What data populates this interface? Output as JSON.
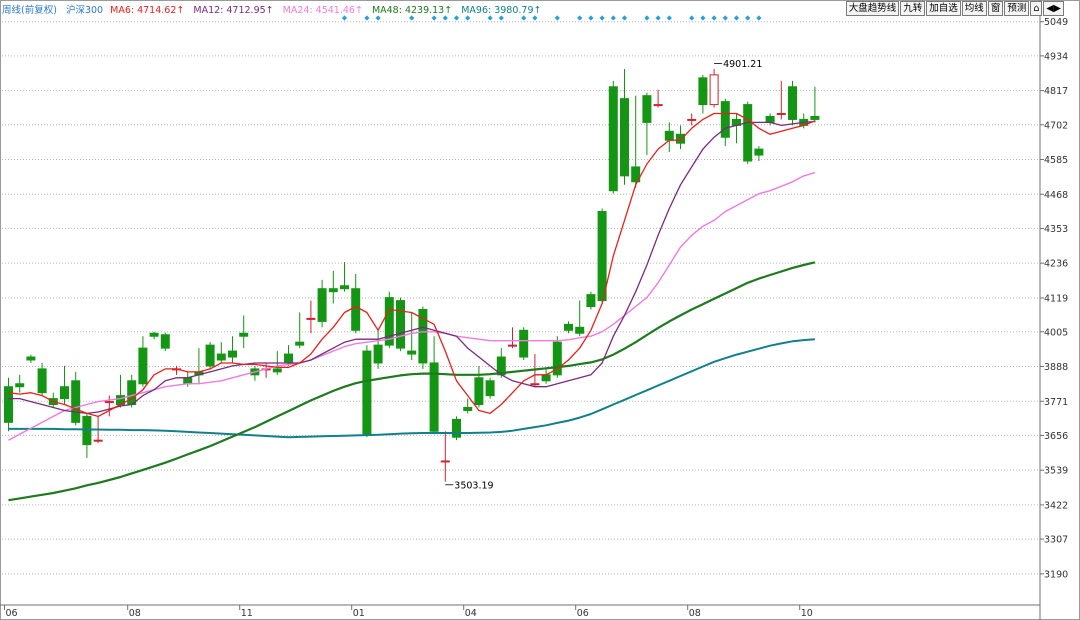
{
  "header": {
    "label": "周线(前复权)",
    "symbol": "沪深300",
    "ma": [
      {
        "text": "MA6: 4714.62↑",
        "color": "#e8201c"
      },
      {
        "text": "MA12: 4712.95↑",
        "color": "#7b2a7b"
      },
      {
        "text": "MA24: 4541.46↑",
        "color": "#f07ae0"
      },
      {
        "text": "MA48: 4239.13↑",
        "color": "#1e7a1e"
      },
      {
        "text": "MA96: 3980.79↑",
        "color": "#11808a"
      }
    ]
  },
  "toolbar": {
    "buttons": [
      "大盘趋势线",
      "九转",
      "加自选",
      "均线",
      "窗",
      "预测",
      "⌂",
      "◀▶"
    ]
  },
  "colors": {
    "up": "#d2232a",
    "down": "#149614",
    "grid": "#b8b8b8",
    "markers": "#2a9fd8",
    "ma6": "#e8201c",
    "ma12": "#7b2a7b",
    "ma24": "#f07ae0",
    "ma48": "#1e7a1e",
    "ma96": "#11808a"
  },
  "chart_data": {
    "type": "candlestick",
    "ylim": [
      3085,
      5075
    ],
    "yticks": [
      5049,
      4934,
      4817,
      4702,
      4585,
      4468,
      4353,
      4236,
      4119,
      4005,
      3888,
      3771,
      3656,
      3539,
      3422,
      3307,
      3190
    ],
    "xticks": [
      {
        "i": 0,
        "label": "06"
      },
      {
        "i": 11,
        "label": "08"
      },
      {
        "i": 21,
        "label": "11"
      },
      {
        "i": 31,
        "label": "01"
      },
      {
        "i": 41,
        "label": "04"
      },
      {
        "i": 51,
        "label": "06"
      },
      {
        "i": 61,
        "label": "08"
      },
      {
        "i": 71,
        "label": "10"
      }
    ],
    "annotations": [
      {
        "i": 63,
        "value": 4901.21,
        "text": "4901.21"
      },
      {
        "i": 39,
        "value": 3503.19,
        "text": "3503.19"
      }
    ],
    "marker_bars": [
      30,
      32,
      33,
      36,
      38,
      39,
      40,
      41,
      43,
      44,
      46,
      47,
      49,
      51,
      52,
      53,
      54,
      55,
      57,
      58,
      59,
      61,
      62,
      63,
      64,
      65,
      66,
      67
    ],
    "candles": [
      [
        3820,
        3850,
        3700,
        3670
      ],
      [
        3830,
        3860,
        3820,
        3800
      ],
      [
        3920,
        3928,
        3910,
        3900
      ],
      [
        3880,
        3900,
        3800,
        3790
      ],
      [
        3780,
        3800,
        3760,
        3750
      ],
      [
        3820,
        3890,
        3780,
        3760
      ],
      [
        3840,
        3870,
        3700,
        3690
      ],
      [
        3720,
        3730,
        3625,
        3580
      ],
      [
        3640,
        3720,
        3640,
        3630
      ],
      [
        3770,
        3790,
        3770,
        3720
      ],
      [
        3790,
        3860,
        3760,
        3750
      ],
      [
        3840,
        3860,
        3760,
        3750
      ],
      [
        3950,
        3990,
        3830,
        3820
      ],
      [
        4000,
        4005,
        3990,
        3980
      ],
      [
        3995,
        4002,
        3950,
        3940
      ],
      [
        3880,
        3890,
        3880,
        3860
      ],
      [
        3850,
        3870,
        3830,
        3820
      ],
      [
        3870,
        3950,
        3860,
        3830
      ],
      [
        3960,
        3970,
        3890,
        3880
      ],
      [
        3930,
        3970,
        3910,
        3900
      ],
      [
        3940,
        3990,
        3920,
        3900
      ],
      [
        4000,
        4060,
        3990,
        3950
      ],
      [
        3880,
        3890,
        3860,
        3840
      ],
      [
        3880,
        3900,
        3880,
        3850
      ],
      [
        3880,
        3940,
        3870,
        3860
      ],
      [
        3930,
        3960,
        3900,
        3890
      ],
      [
        3970,
        4070,
        3960,
        3950
      ],
      [
        4050,
        4110,
        4050,
        4000
      ],
      [
        4150,
        4180,
        4040,
        4020
      ],
      [
        4150,
        4210,
        4140,
        4100
      ],
      [
        4160,
        4240,
        4150,
        4140
      ],
      [
        4150,
        4200,
        4010,
        4000
      ],
      [
        3940,
        3960,
        3660,
        3650
      ],
      [
        3960,
        4010,
        3900,
        3880
      ],
      [
        4120,
        4140,
        3960,
        3950
      ],
      [
        4110,
        4120,
        3950,
        3940
      ],
      [
        3940,
        4070,
        3930,
        3910
      ],
      [
        4080,
        4090,
        3900,
        3880
      ],
      [
        3900,
        3990,
        3670,
        3660
      ],
      [
        3570,
        3670,
        3570,
        3500
      ],
      [
        3710,
        3720,
        3650,
        3640
      ],
      [
        3750,
        3780,
        3740,
        3730
      ],
      [
        3850,
        3890,
        3760,
        3750
      ],
      [
        3840,
        3850,
        3790,
        3780
      ],
      [
        3920,
        3950,
        3860,
        3850
      ],
      [
        3960,
        4020,
        3960,
        3950
      ],
      [
        4010,
        4020,
        3920,
        3910
      ],
      [
        3830,
        3930,
        3830,
        3820
      ],
      [
        3860,
        3880,
        3840,
        3830
      ],
      [
        3970,
        3990,
        3860,
        3850
      ],
      [
        4030,
        4040,
        4010,
        4000
      ],
      [
        4020,
        4110,
        4000,
        3990
      ],
      [
        4130,
        4140,
        4090,
        4080
      ],
      [
        4410,
        4420,
        4110,
        4100
      ],
      [
        4830,
        4850,
        4480,
        4470
      ],
      [
        4790,
        4890,
        4530,
        4500
      ],
      [
        4560,
        4800,
        4510,
        4490
      ],
      [
        4800,
        4810,
        4710,
        4600
      ],
      [
        4770,
        4820,
        4770,
        4760
      ],
      [
        4680,
        4710,
        4650,
        4610
      ],
      [
        4670,
        4700,
        4640,
        4620
      ],
      [
        4720,
        4740,
        4720,
        4700
      ],
      [
        4860,
        4870,
        4770,
        4740
      ],
      [
        4770,
        4890,
        4870,
        4760
      ],
      [
        4780,
        4790,
        4660,
        4630
      ],
      [
        4720,
        4740,
        4700,
        4640
      ],
      [
        4770,
        4780,
        4580,
        4570
      ],
      [
        4620,
        4630,
        4600,
        4580
      ],
      [
        4730,
        4740,
        4710,
        4700
      ],
      [
        4740,
        4850,
        4740,
        4720
      ],
      [
        4830,
        4850,
        4720,
        4700
      ],
      [
        4720,
        4740,
        4700,
        4690
      ],
      [
        4730,
        4830,
        4720,
        4710
      ]
    ],
    "ma6": [
      3800,
      3795,
      3800,
      3790,
      3770,
      3760,
      3745,
      3730,
      3720,
      3740,
      3760,
      3780,
      3810,
      3860,
      3880,
      3880,
      3870,
      3870,
      3880,
      3900,
      3900,
      3895,
      3895,
      3890,
      3885,
      3885,
      3900,
      3930,
      3980,
      4020,
      4070,
      4090,
      4070,
      4010,
      4080,
      4075,
      4070,
      4050,
      4030,
      3940,
      3840,
      3790,
      3740,
      3730,
      3760,
      3800,
      3840,
      3860,
      3860,
      3880,
      3910,
      3950,
      4010,
      4100,
      4260,
      4380,
      4500,
      4570,
      4620,
      4650,
      4650,
      4690,
      4720,
      4740,
      4740,
      4740,
      4720,
      4690,
      4670,
      4680,
      4690,
      4700,
      4715
    ],
    "ma12": [
      3780,
      3780,
      3770,
      3760,
      3750,
      3740,
      3735,
      3730,
      3735,
      3745,
      3755,
      3760,
      3790,
      3810,
      3840,
      3850,
      3850,
      3860,
      3870,
      3880,
      3890,
      3895,
      3900,
      3900,
      3900,
      3900,
      3900,
      3910,
      3930,
      3950,
      3970,
      3980,
      3980,
      3980,
      3990,
      4000,
      4010,
      4020,
      4010,
      4000,
      3990,
      3950,
      3920,
      3890,
      3860,
      3840,
      3830,
      3820,
      3820,
      3830,
      3840,
      3850,
      3860,
      3900,
      3990,
      4060,
      4140,
      4230,
      4330,
      4420,
      4500,
      4560,
      4620,
      4660,
      4690,
      4700,
      4710,
      4710,
      4710,
      4700,
      4705,
      4710,
      4713
    ],
    "ma24": [
      3640,
      3660,
      3680,
      3700,
      3720,
      3740,
      3750,
      3760,
      3770,
      3775,
      3780,
      3790,
      3800,
      3810,
      3820,
      3825,
      3830,
      3830,
      3835,
      3840,
      3850,
      3860,
      3870,
      3880,
      3890,
      3895,
      3900,
      3910,
      3925,
      3940,
      3955,
      3965,
      3970,
      3975,
      3980,
      3990,
      4000,
      4005,
      4005,
      4000,
      3990,
      3985,
      3980,
      3975,
      3975,
      3975,
      3975,
      3975,
      3975,
      3975,
      3978,
      3985,
      3990,
      4005,
      4030,
      4060,
      4090,
      4120,
      4170,
      4230,
      4290,
      4330,
      4360,
      4380,
      4410,
      4430,
      4450,
      4470,
      4480,
      4495,
      4510,
      4530,
      4541
    ],
    "ma48": [
      3438,
      3444,
      3450,
      3456,
      3462,
      3470,
      3478,
      3488,
      3496,
      3506,
      3516,
      3528,
      3540,
      3552,
      3564,
      3578,
      3592,
      3606,
      3620,
      3636,
      3652,
      3668,
      3684,
      3702,
      3720,
      3738,
      3756,
      3774,
      3790,
      3806,
      3820,
      3832,
      3840,
      3846,
      3852,
      3858,
      3862,
      3864,
      3864,
      3862,
      3860,
      3860,
      3860,
      3862,
      3866,
      3870,
      3874,
      3878,
      3882,
      3886,
      3890,
      3896,
      3902,
      3912,
      3928,
      3948,
      3970,
      3994,
      4018,
      4040,
      4060,
      4080,
      4098,
      4116,
      4134,
      4152,
      4170,
      4184,
      4196,
      4208,
      4220,
      4230,
      4239
    ],
    "ma96": [
      3678,
      3678,
      3678,
      3678,
      3678,
      3677,
      3677,
      3676,
      3676,
      3675,
      3675,
      3674,
      3674,
      3673,
      3672,
      3670,
      3668,
      3666,
      3664,
      3662,
      3660,
      3658,
      3656,
      3654,
      3652,
      3650,
      3651,
      3652,
      3653,
      3654,
      3655,
      3656,
      3657,
      3658,
      3660,
      3662,
      3663,
      3664,
      3664,
      3664,
      3664,
      3664,
      3665,
      3666,
      3668,
      3672,
      3678,
      3684,
      3690,
      3698,
      3706,
      3716,
      3728,
      3744,
      3760,
      3776,
      3792,
      3808,
      3824,
      3840,
      3856,
      3872,
      3888,
      3904,
      3916,
      3928,
      3938,
      3948,
      3958,
      3966,
      3973,
      3977,
      3980
    ]
  }
}
